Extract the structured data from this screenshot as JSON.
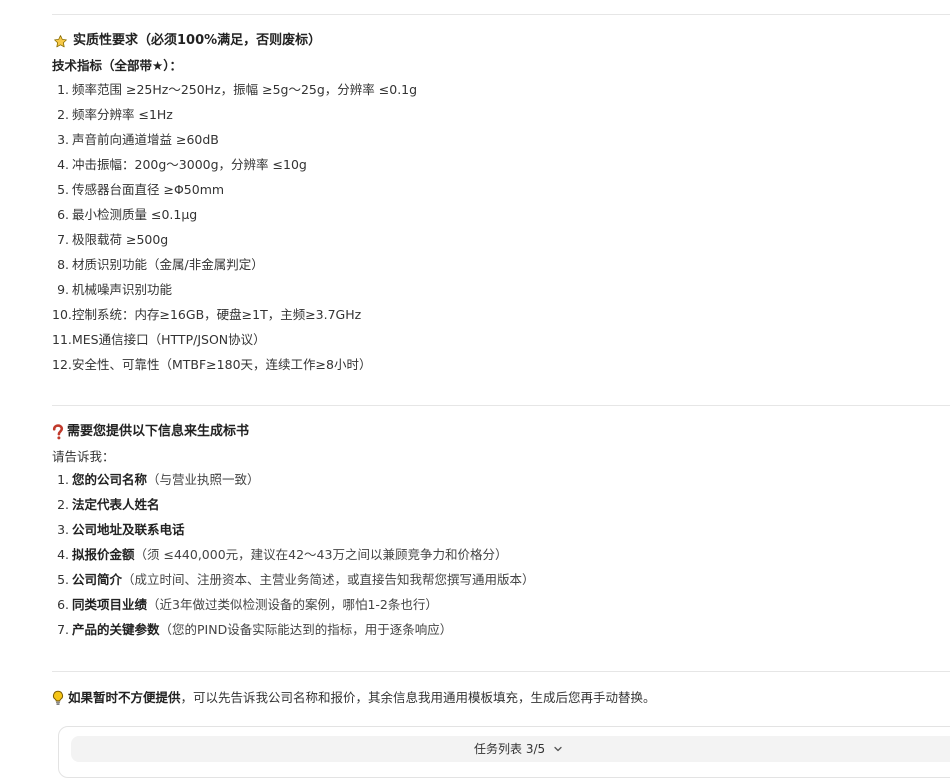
{
  "requirements": {
    "title": "实质性要求（必须100%满足，否则废标）",
    "subtitle": "技术指标（全部带★）：",
    "items": [
      {
        "num": "1.",
        "text": "频率范围 ≥25Hz～250Hz，振幅 ≥5g～25g，分辨率 ≤0.1g"
      },
      {
        "num": "2.",
        "text": "频率分辨率 ≤1Hz"
      },
      {
        "num": "3.",
        "text": "声音前向通道增益 ≥60dB"
      },
      {
        "num": "4.",
        "text": "冲击振幅：200g～3000g，分辨率 ≤10g"
      },
      {
        "num": "5.",
        "text": "传感器台面直径 ≥Φ50mm"
      },
      {
        "num": "6.",
        "text": "最小检测质量 ≤0.1μg"
      },
      {
        "num": "7.",
        "text": "极限载荷 ≥500g"
      },
      {
        "num": "8.",
        "text": "材质识别功能（金属/非金属判定）"
      },
      {
        "num": "9.",
        "text": "机械噪声识别功能"
      },
      {
        "num": "10.",
        "text": "控制系统：内存≥16GB，硬盘≥1T，主频≥3.7GHz"
      },
      {
        "num": "11.",
        "text": "MES通信接口（HTTP/JSON协议）"
      },
      {
        "num": "12.",
        "text": "安全性、可靠性（MTBF≥180天，连续工作≥8小时）"
      }
    ]
  },
  "info_needed": {
    "title": "需要您提供以下信息来生成标书",
    "intro": "请告诉我：",
    "items": [
      {
        "num": "1.",
        "label": "您的公司名称",
        "note": "（与营业执照一致）"
      },
      {
        "num": "2.",
        "label": "法定代表人姓名",
        "note": ""
      },
      {
        "num": "3.",
        "label": "公司地址及联系电话",
        "note": ""
      },
      {
        "num": "4.",
        "label": "拟报价金额",
        "note": "（须 ≤440,000元，建议在42～43万之间以兼顾竞争力和价格分）"
      },
      {
        "num": "5.",
        "label": "公司简介",
        "note": "（成立时间、注册资本、主营业务简述，或直接告知我帮您撰写通用版本）"
      },
      {
        "num": "6.",
        "label": "同类项目业绩",
        "note": "（近3年做过类似检测设备的案例，哪怕1-2条也行）"
      },
      {
        "num": "7.",
        "label": "产品的关键参数",
        "note": "（您的PIND设备实际能达到的指标，用于逐条响应）"
      }
    ]
  },
  "tip": {
    "bold": "如果暂时不方便提供",
    "rest": "，可以先告诉我公司名称和报价，其余信息我用通用模板填充，生成后您再手动替换。"
  },
  "task_list": {
    "label": "任务列表 3/5"
  },
  "icons": {
    "star": "star-icon",
    "question": "question-mark-icon",
    "bulb": "lightbulb-icon",
    "chevron": "chevron-down-icon"
  },
  "colors": {
    "star_fill": "#f7c948",
    "question_red": "#c0392b",
    "bulb_yellow": "#f5c518"
  }
}
